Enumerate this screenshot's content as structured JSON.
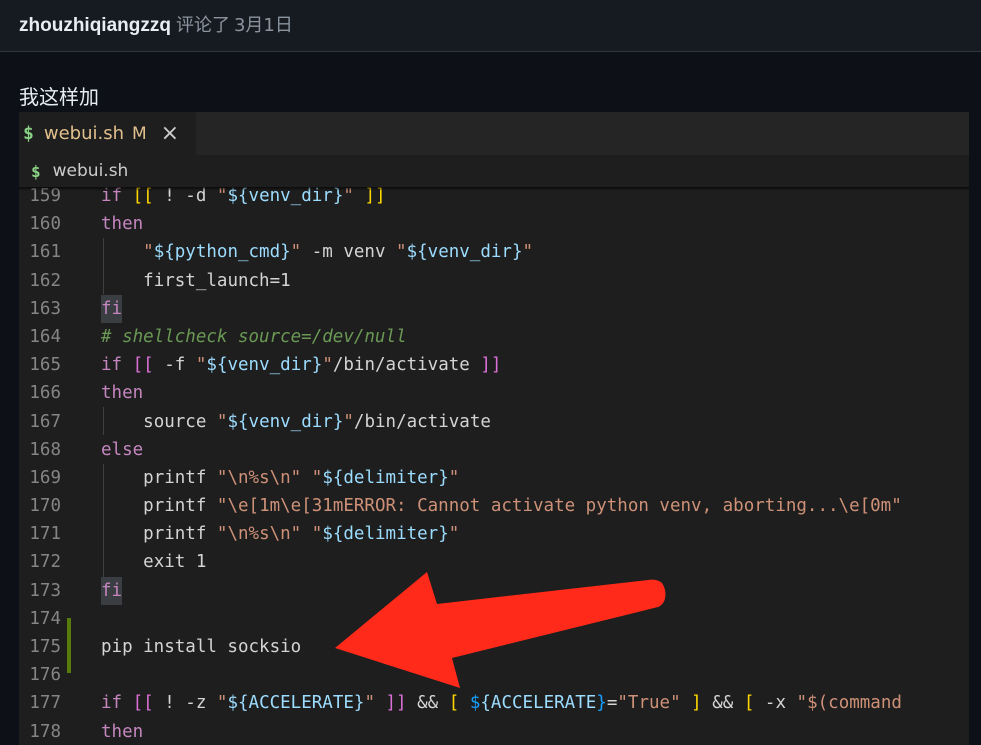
{
  "comment": {
    "author": "zhouzhiqiangzzq",
    "action": "评论了",
    "date": "3月1日",
    "body": "我这样加"
  },
  "editor": {
    "tab": {
      "icon": "$",
      "filename": "webui.sh",
      "status": "M",
      "close": "×"
    },
    "breadcrumb": {
      "icon": "$",
      "filename": "webui.sh"
    },
    "lines": [
      {
        "n": "159"
      },
      {
        "n": "160"
      },
      {
        "n": "161"
      },
      {
        "n": "162"
      },
      {
        "n": "163"
      },
      {
        "n": "164"
      },
      {
        "n": "165"
      },
      {
        "n": "166"
      },
      {
        "n": "167"
      },
      {
        "n": "168"
      },
      {
        "n": "169"
      },
      {
        "n": "170"
      },
      {
        "n": "171"
      },
      {
        "n": "172"
      },
      {
        "n": "173"
      },
      {
        "n": "174"
      },
      {
        "n": "175"
      },
      {
        "n": "176"
      },
      {
        "n": "177"
      },
      {
        "n": "178"
      }
    ],
    "code": {
      "l159": [
        "if",
        "[[",
        " ! -d ",
        "\"${venv_dir}\"",
        " ]]"
      ],
      "l160": "then",
      "l161": [
        "\"${python_cmd}\"",
        " -m venv ",
        "\"${venv_dir}\""
      ],
      "l162": "first_launch=1",
      "l163": "fi",
      "l164": "# shellcheck source=/dev/null",
      "l165": [
        "if",
        "[[",
        " -f ",
        "\"${venv_dir}\"",
        "/bin/activate ",
        "]]"
      ],
      "l166": "then",
      "l167": [
        "source ",
        "\"${venv_dir}\"",
        "/bin/activate"
      ],
      "l168": "else",
      "l169": [
        "printf ",
        "\"\\n%s\\n\"",
        " ",
        "\"${delimiter}\""
      ],
      "l170": [
        "printf ",
        "\"\\e[1m\\e[31mERROR: Cannot activate python venv, aborting...\\e[0m\""
      ],
      "l171": [
        "printf ",
        "\"\\n%s\\n\"",
        " ",
        "\"${delimiter}\""
      ],
      "l172": "exit 1",
      "l173": "fi",
      "l175": "pip install socksio",
      "l177": [
        "if",
        "[[",
        " ! -z ",
        "\"${ACCELERATE}\"",
        " ]]",
        " && ",
        "[",
        " ${ACCELERATE}",
        "=",
        "\"True\"",
        " ]",
        " && ",
        "[",
        " -x ",
        "\"$(command"
      ],
      "l178": "then"
    }
  },
  "annotation": {
    "type": "arrow",
    "color": "#ff2a1a"
  }
}
